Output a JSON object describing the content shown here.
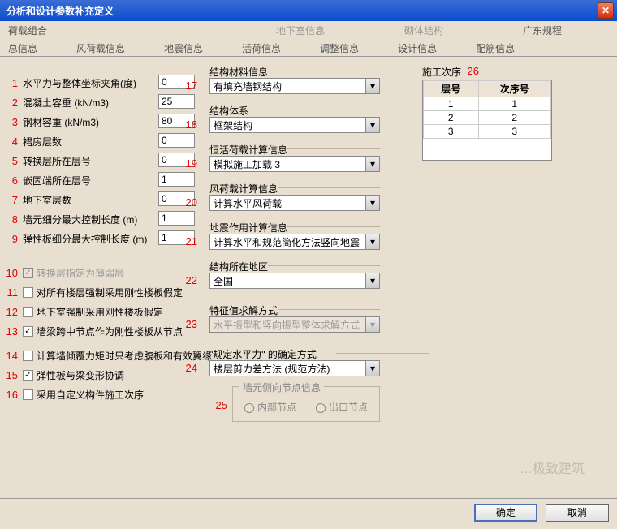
{
  "window": {
    "title": "分析和设计参数补充定义"
  },
  "tabs1": [
    {
      "label": "荷载组合",
      "state": "selected"
    },
    {
      "label": "地下室信息",
      "state": "disabled"
    },
    {
      "label": "砌体结构",
      "state": "disabled"
    },
    {
      "label": "广东规程",
      "state": "normal"
    }
  ],
  "tabs2": [
    {
      "label": "总信息"
    },
    {
      "label": "风荷载信息"
    },
    {
      "label": "地震信息"
    },
    {
      "label": "活荷信息"
    },
    {
      "label": "调整信息"
    },
    {
      "label": "设计信息"
    },
    {
      "label": "配筋信息"
    }
  ],
  "left": [
    {
      "n": "1",
      "label": "水平力与整体坐标夹角(度)",
      "value": "0"
    },
    {
      "n": "2",
      "label": "混凝土容重  (kN/m3)",
      "value": "25"
    },
    {
      "n": "3",
      "label": "钢材容重   (kN/m3)",
      "value": "80"
    },
    {
      "n": "4",
      "label": "裙房层数",
      "value": "0"
    },
    {
      "n": "5",
      "label": "转换层所在层号",
      "value": "0"
    },
    {
      "n": "6",
      "label": "嵌固端所在层号",
      "value": "1"
    },
    {
      "n": "7",
      "label": "地下室层数",
      "value": "0"
    },
    {
      "n": "8",
      "label": "墙元细分最大控制长度 (m)",
      "value": "1"
    },
    {
      "n": "9",
      "label": "弹性板细分最大控制长度 (m)",
      "value": "1"
    }
  ],
  "checks": [
    {
      "n": "10",
      "label": "转换层指定为薄弱层",
      "checked": true,
      "disabled": true
    },
    {
      "n": "11",
      "label": "对所有楼层强制采用刚性楼板假定",
      "checked": false
    },
    {
      "n": "12",
      "label": "地下室强制采用刚性楼板假定",
      "checked": false
    },
    {
      "n": "13",
      "label": "墙梁跨中节点作为刚性楼板从节点",
      "checked": true
    },
    {
      "n": "14",
      "label": "计算墙倾覆力矩时只考虑腹板和有效翼缘",
      "checked": false
    },
    {
      "n": "15",
      "label": "弹性板与梁变形协调",
      "checked": true
    },
    {
      "n": "16",
      "label": "采用自定义构件施工次序",
      "checked": false
    }
  ],
  "combos": [
    {
      "n": "17",
      "section": "结构材料信息",
      "value": "有填充墙钢结构"
    },
    {
      "n": "18",
      "section": "结构体系",
      "value": "框架结构"
    },
    {
      "n": "19",
      "section": "恒活荷载计算信息",
      "value": "模拟施工加载  3"
    },
    {
      "n": "20",
      "section": "风荷载计算信息",
      "value": "计算水平风荷载"
    },
    {
      "n": "21",
      "section": "地震作用计算信息",
      "value": "计算水平和规范简化方法竖向地震"
    },
    {
      "n": "22",
      "section": "结构所在地区",
      "value": "全国"
    },
    {
      "n": "23",
      "section": "特征值求解方式",
      "value": "水平振型和竖向振型整体求解方式",
      "disabled": true
    },
    {
      "n": "24",
      "section": "\"规定水平力\" 的确定方式",
      "value": "楼层剪力差方法 (规范方法)"
    }
  ],
  "sidejoint": {
    "n": "25",
    "section": "墙元侧向节点信息",
    "opt1": "内部节点",
    "opt2": "出口节点"
  },
  "construction": {
    "n": "26",
    "section": "施工次序",
    "headers": [
      "层号",
      "次序号"
    ],
    "rows": [
      [
        "1",
        "1"
      ],
      [
        "2",
        "2"
      ],
      [
        "3",
        "3"
      ]
    ]
  },
  "buttons": {
    "ok": "确定",
    "cancel": "取消"
  },
  "watermark": "…极致建筑"
}
